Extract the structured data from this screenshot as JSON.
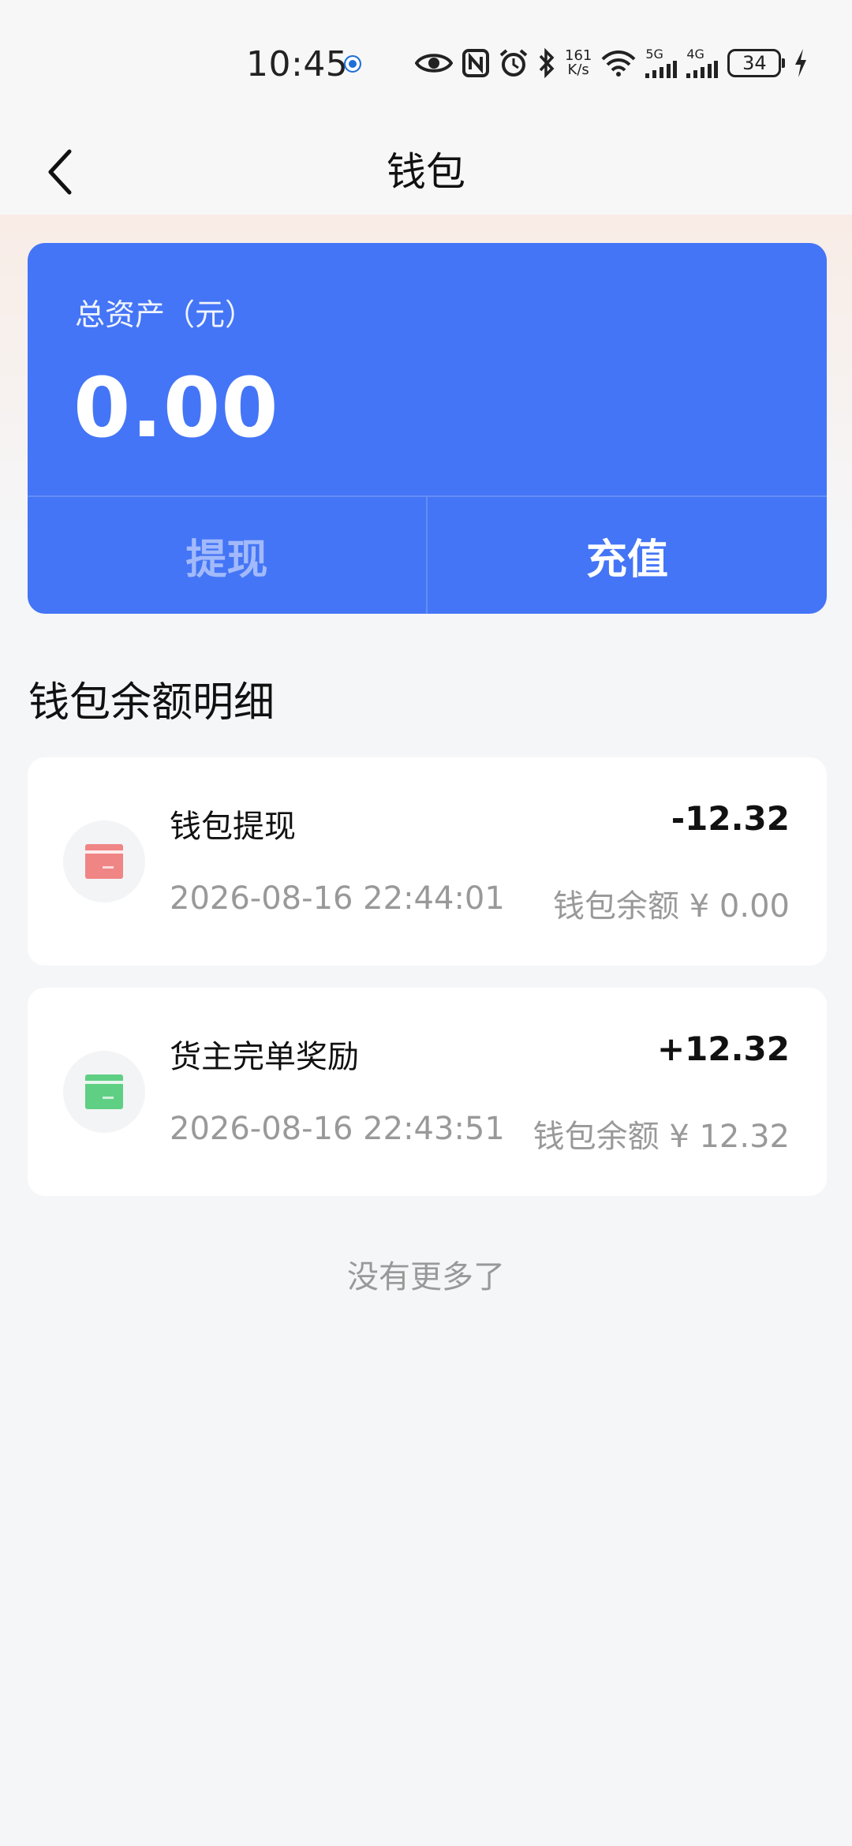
{
  "status_bar": {
    "time": "10:45",
    "net_speed_value": "161",
    "net_speed_unit": "K/s",
    "signal_1_label": "5G",
    "signal_2_label": "4G",
    "battery": "34",
    "icons": [
      "app-notification-icon",
      "eye-icon",
      "nfc-icon",
      "alarm-icon",
      "bluetooth-icon",
      "wifi-icon",
      "signal-5g-icon",
      "signal-4g-icon",
      "battery-icon",
      "charging-icon"
    ]
  },
  "header": {
    "title": "钱包",
    "back_icon": "chevron-left-icon"
  },
  "asset_card": {
    "label": "总资产（元）",
    "value": "0.00",
    "withdraw_label": "提现",
    "recharge_label": "充值",
    "bg_color": "#4475f6"
  },
  "section": {
    "title": "钱包余额明细"
  },
  "records": [
    {
      "name": "钱包提现",
      "amount": "-12.32",
      "time": "2026-08-16 22:44:01",
      "balance": "钱包余额 ¥ 0.00",
      "icon": "withdraw-card-icon",
      "icon_color": "#f08585"
    },
    {
      "name": "货主完单奖励",
      "amount": "+12.32",
      "time": "2026-08-16 22:43:51",
      "balance": "钱包余额 ¥ 12.32",
      "icon": "reward-card-icon",
      "icon_color": "#5fcf84"
    }
  ],
  "footer": {
    "no_more": "没有更多了"
  }
}
